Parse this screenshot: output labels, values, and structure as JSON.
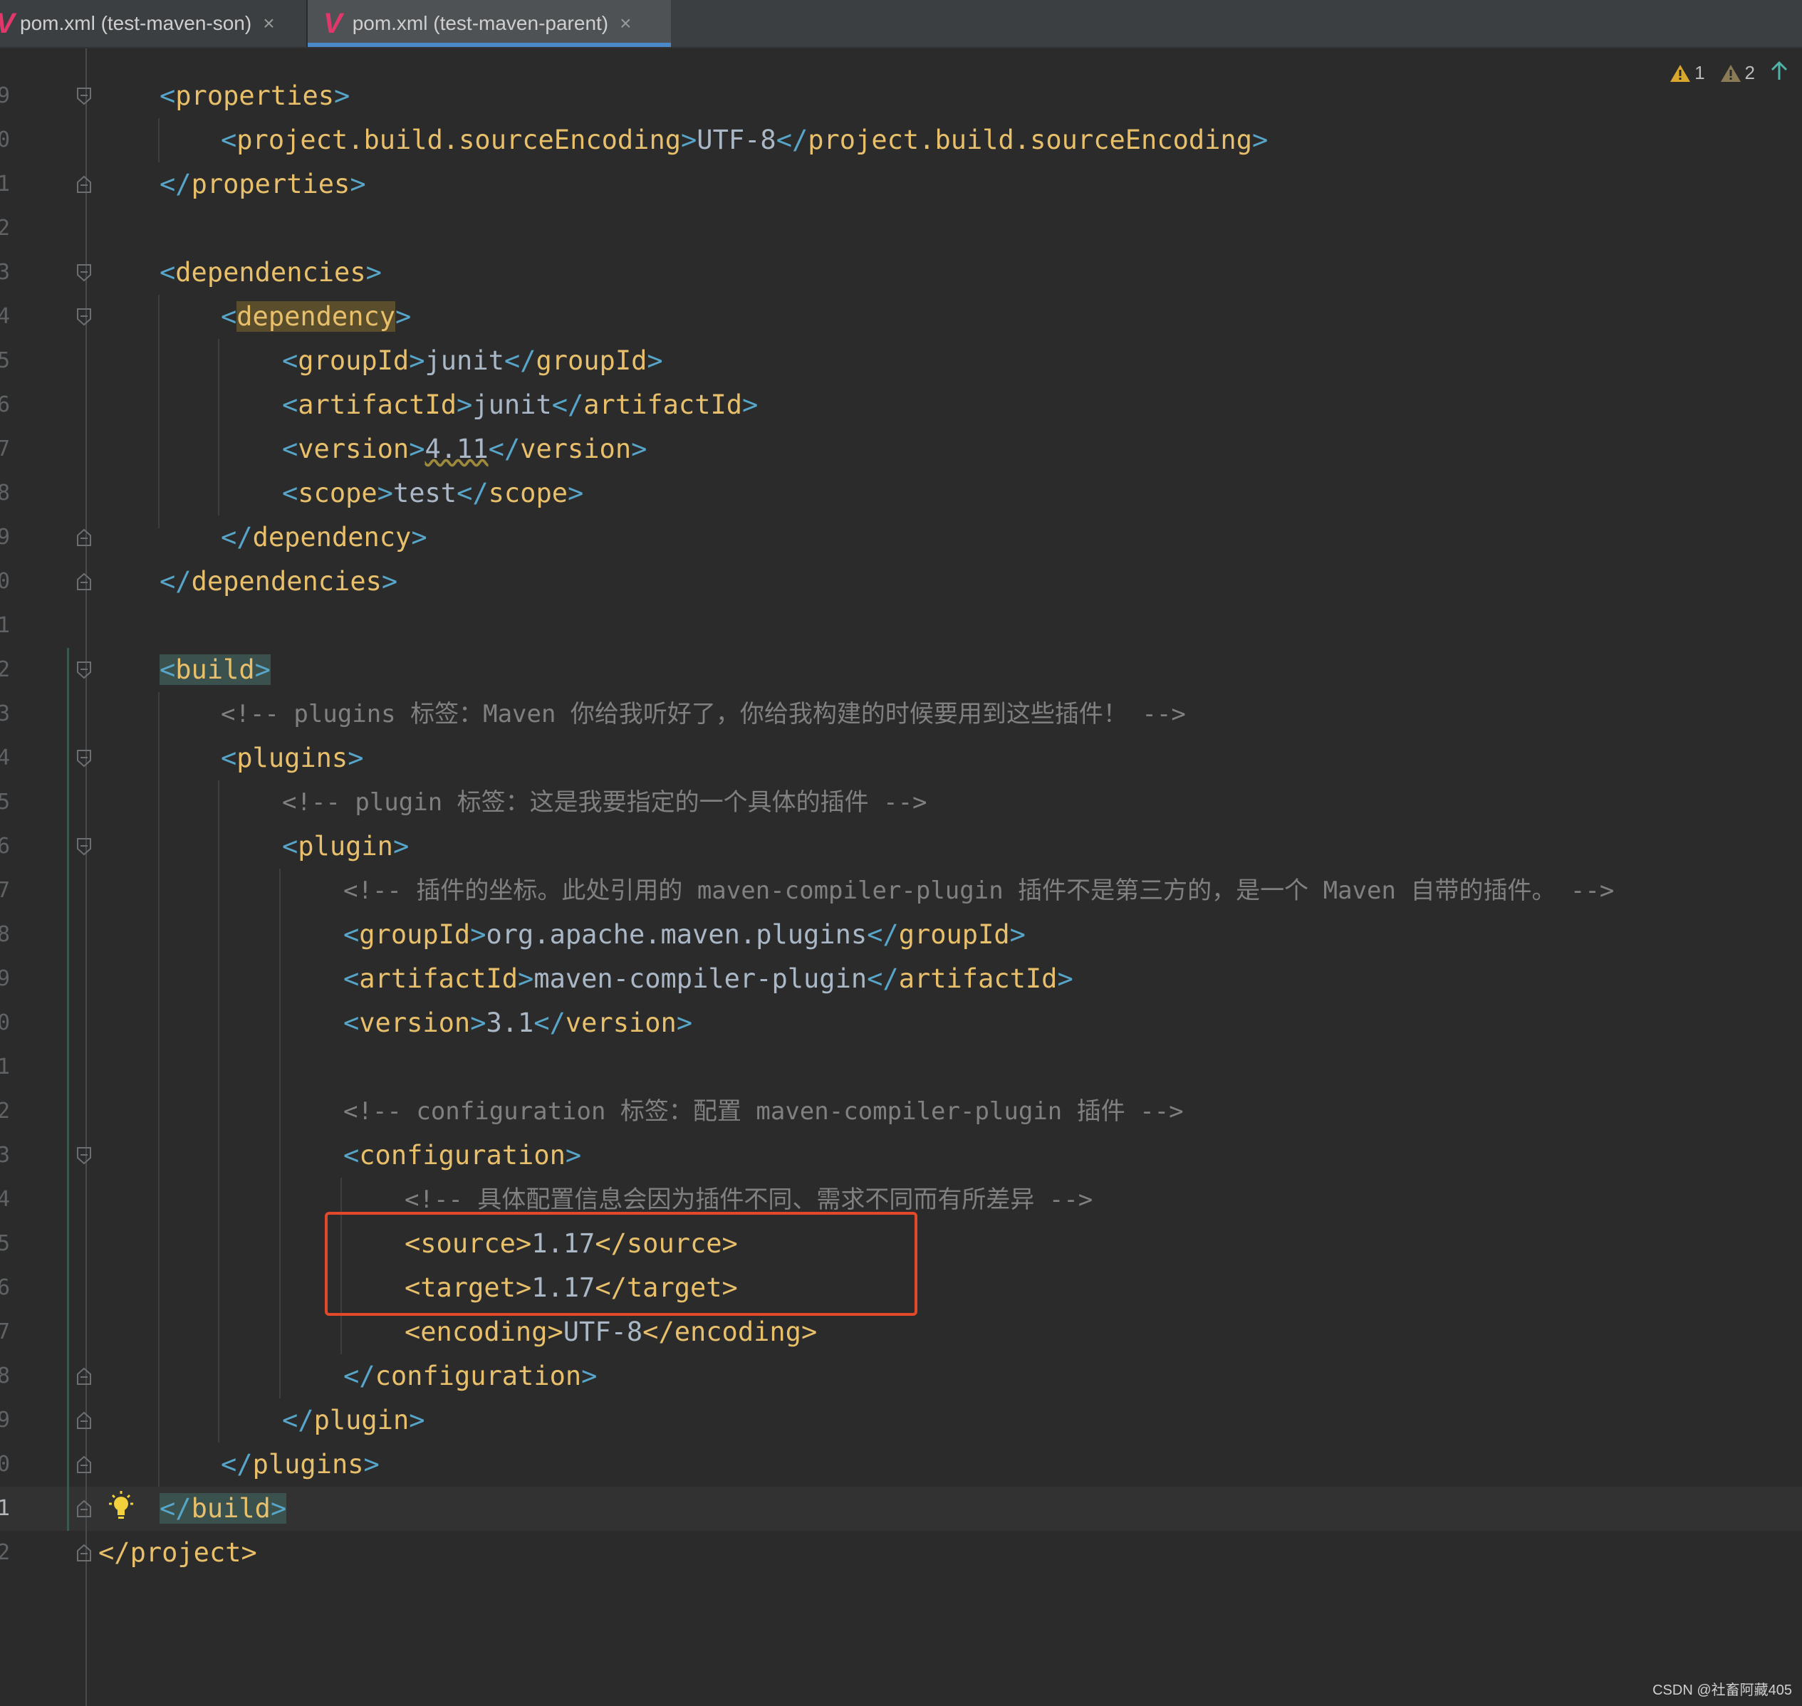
{
  "tabs": [
    {
      "label": "pom.xml (test-maven-son)",
      "close": "×"
    },
    {
      "label": "pom.xml (test-maven-parent)",
      "close": "×"
    }
  ],
  "inspections": {
    "warnings": "1",
    "weak_warnings": "2"
  },
  "line_numbers": [
    "9",
    "0",
    "1",
    "2",
    "3",
    "4",
    "5",
    "6",
    "7",
    "8",
    "9",
    "0",
    "1",
    "2",
    "3",
    "4",
    "5",
    "6",
    "7",
    "8",
    "9",
    "0",
    "1",
    "2",
    "3",
    "4",
    "5",
    "6",
    "7",
    "8",
    "9",
    "0",
    "1",
    "2"
  ],
  "code": {
    "l9": {
      "open": "<",
      "tag": "properties",
      "close": ">"
    },
    "l10": {
      "open": "<",
      "tag": "project.build.sourceEncoding",
      "close": ">",
      "text": "UTF-8",
      "open2": "</",
      "tag2": "project.build.sourceEncoding",
      "close2": ">"
    },
    "l11": {
      "open": "</",
      "tag": "properties",
      "close": ">"
    },
    "l13": {
      "open": "<",
      "tag": "dependencies",
      "close": ">"
    },
    "l14": {
      "open": "<",
      "tag": "dependency",
      "close": ">"
    },
    "l15": {
      "open": "<",
      "tag": "groupId",
      "close": ">",
      "text": "junit",
      "open2": "</",
      "tag2": "groupId",
      "close2": ">"
    },
    "l16": {
      "open": "<",
      "tag": "artifactId",
      "close": ">",
      "text": "junit",
      "open2": "</",
      "tag2": "artifactId",
      "close2": ">"
    },
    "l17": {
      "open": "<",
      "tag": "version",
      "close": ">",
      "text": "4.11",
      "open2": "</",
      "tag2": "version",
      "close2": ">"
    },
    "l18": {
      "open": "<",
      "tag": "scope",
      "close": ">",
      "text": "test",
      "open2": "</",
      "tag2": "scope",
      "close2": ">"
    },
    "l19": {
      "open": "</",
      "tag": "dependency",
      "close": ">"
    },
    "l20": {
      "open": "</",
      "tag": "dependencies",
      "close": ">"
    },
    "l22": {
      "open": "<",
      "tag": "build",
      "close": ">"
    },
    "l23": {
      "comment": "<!-- plugins 标签：Maven 你给我听好了，你给我构建的时候要用到这些插件！ -->"
    },
    "l24": {
      "open": "<",
      "tag": "plugins",
      "close": ">"
    },
    "l25": {
      "comment": "<!-- plugin 标签：这是我要指定的一个具体的插件 -->"
    },
    "l26": {
      "open": "<",
      "tag": "plugin",
      "close": ">"
    },
    "l27": {
      "comment": "<!-- 插件的坐标。此处引用的 maven-compiler-plugin 插件不是第三方的，是一个 Maven 自带的插件。 -->"
    },
    "l28": {
      "open": "<",
      "tag": "groupId",
      "close": ">",
      "text": "org.apache.maven.plugins",
      "open2": "</",
      "tag2": "groupId",
      "close2": ">"
    },
    "l29": {
      "open": "<",
      "tag": "artifactId",
      "close": ">",
      "text": "maven-compiler-plugin",
      "open2": "</",
      "tag2": "artifactId",
      "close2": ">"
    },
    "l30": {
      "open": "<",
      "tag": "version",
      "close": ">",
      "text": "3.1",
      "open2": "</",
      "tag2": "version",
      "close2": ">"
    },
    "l32": {
      "comment": "<!-- configuration 标签：配置 maven-compiler-plugin 插件 -->"
    },
    "l33": {
      "open": "<",
      "tag": "configuration",
      "close": ">"
    },
    "l34": {
      "comment": "<!-- 具体配置信息会因为插件不同、需求不同而有所差异 -->"
    },
    "l35": {
      "open": "<",
      "tag": "source",
      "close": ">",
      "text": "1.17",
      "open2": "</",
      "tag2": "source",
      "close2": ">"
    },
    "l36": {
      "open": "<",
      "tag": "target",
      "close": ">",
      "text": "1.17",
      "open2": "</",
      "tag2": "target",
      "close2": ">"
    },
    "l37": {
      "open": "<",
      "tag": "encoding",
      "close": ">",
      "text": "UTF-8",
      "open2": "</",
      "tag2": "encoding",
      "close2": ">"
    },
    "l38": {
      "open": "</",
      "tag": "configuration",
      "close": ">"
    },
    "l39": {
      "open": "</",
      "tag": "plugin",
      "close": ">"
    },
    "l40": {
      "open": "</",
      "tag": "plugins",
      "close": ">"
    },
    "l41": {
      "open": "</",
      "tag": "build",
      "close": ">"
    },
    "l42": {
      "open": "</",
      "tag": "project",
      "close": ">"
    }
  },
  "watermark": "CSDN @社畜阿藏405",
  "colors": {
    "tag": "#e8bf6a",
    "bracket": "#57a6c9",
    "text": "#a9b7c6",
    "comment": "#808080",
    "annotation": "#e2482a",
    "tab_accent": "#4a88c7"
  }
}
